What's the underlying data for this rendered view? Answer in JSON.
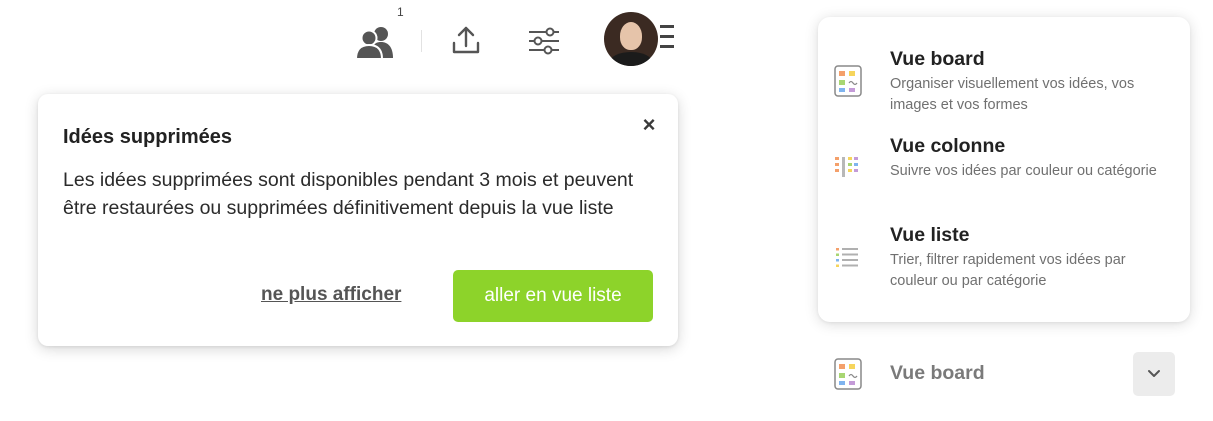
{
  "toolbar": {
    "users_count": "1",
    "icons": [
      "users-icon",
      "upload-icon",
      "sliders-icon",
      "avatar",
      "menu-lines-icon"
    ]
  },
  "info_card": {
    "title": "Idées supprimées",
    "body": "Les idées supprimées sont disponibles pendant 3 mois et peuvent être restaurées ou supprimées définitivement depuis la vue liste",
    "close_label": "×",
    "dismiss_link": "ne plus afficher",
    "primary_button": "aller en vue liste",
    "primary_color": "#8dd32a"
  },
  "view_menu": {
    "options": [
      {
        "title": "Vue board",
        "description": "Organiser visuellement vos idées, vos images et vos formes",
        "icon": "board-view-icon"
      },
      {
        "title": "Vue colonne",
        "description": "Suivre vos idées par couleur ou catégorie",
        "icon": "column-view-icon"
      },
      {
        "title": "Vue liste",
        "description": "Trier, filtrer rapidement vos idées par couleur ou par catégorie",
        "icon": "list-view-icon"
      }
    ]
  },
  "current_view": {
    "label": "Vue board",
    "icon": "board-view-icon",
    "toggle_icon": "chevron-down-icon"
  }
}
